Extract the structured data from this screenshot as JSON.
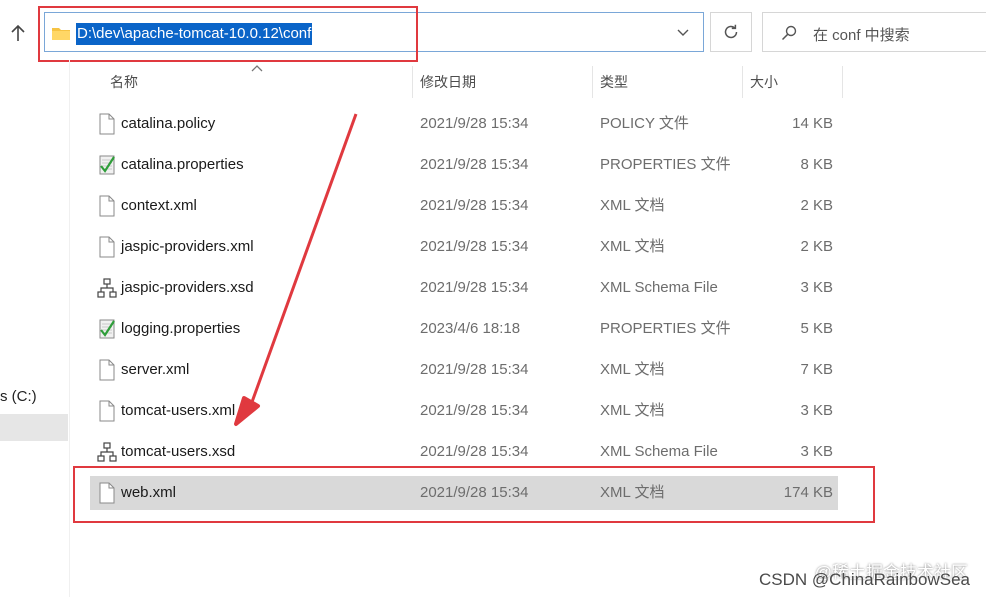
{
  "address_bar": {
    "path": "D:\\dev\\apache-tomcat-10.0.12\\conf"
  },
  "search": {
    "placeholder": "在 conf 中搜索"
  },
  "nav": {
    "drive_label": "s (C:)"
  },
  "columns": {
    "name": "名称",
    "date": "修改日期",
    "type": "类型",
    "size": "大小"
  },
  "files": [
    {
      "name": "catalina.policy",
      "date": "2021/9/28 15:34",
      "type": "POLICY 文件",
      "size": "14 KB",
      "icon": "file-icon"
    },
    {
      "name": "catalina.properties",
      "date": "2021/9/28 15:34",
      "type": "PROPERTIES 文件",
      "size": "8 KB",
      "icon": "properties-file-icon"
    },
    {
      "name": "context.xml",
      "date": "2021/9/28 15:34",
      "type": "XML 文档",
      "size": "2 KB",
      "icon": "file-icon"
    },
    {
      "name": "jaspic-providers.xml",
      "date": "2021/9/28 15:34",
      "type": "XML 文档",
      "size": "2 KB",
      "icon": "file-icon"
    },
    {
      "name": "jaspic-providers.xsd",
      "date": "2021/9/28 15:34",
      "type": "XML Schema File",
      "size": "3 KB",
      "icon": "schema-file-icon"
    },
    {
      "name": "logging.properties",
      "date": "2023/4/6 18:18",
      "type": "PROPERTIES 文件",
      "size": "5 KB",
      "icon": "properties-file-icon"
    },
    {
      "name": "server.xml",
      "date": "2021/9/28 15:34",
      "type": "XML 文档",
      "size": "7 KB",
      "icon": "file-icon"
    },
    {
      "name": "tomcat-users.xml",
      "date": "2021/9/28 15:34",
      "type": "XML 文档",
      "size": "3 KB",
      "icon": "file-icon"
    },
    {
      "name": "tomcat-users.xsd",
      "date": "2021/9/28 15:34",
      "type": "XML Schema File",
      "size": "3 KB",
      "icon": "schema-file-icon"
    },
    {
      "name": "web.xml",
      "date": "2021/9/28 15:34",
      "type": "XML 文档",
      "size": "174 KB",
      "icon": "file-icon",
      "selected": true
    }
  ],
  "watermark": {
    "line1": "@稀土掘金技术社区",
    "line2": "CSDN @ChinaRainbowSea"
  },
  "colors": {
    "highlight_red": "#e0393f",
    "selection_blue": "#0a64c8",
    "selected_row": "#d9d9d9"
  }
}
